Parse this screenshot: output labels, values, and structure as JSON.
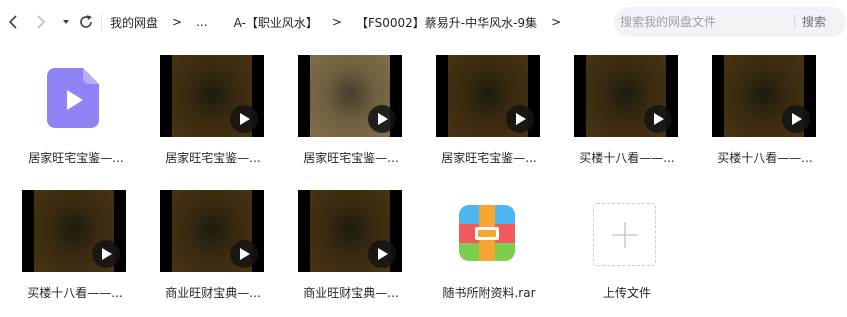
{
  "toolbar": {
    "icons": [
      "chevron-left-icon",
      "chevron-right-icon",
      "caret-down-icon",
      "refresh-icon"
    ],
    "breadcrumbs": [
      {
        "label": "我的网盘"
      },
      {
        "label": "..."
      },
      {
        "label": "A-【职业风水】"
      },
      {
        "label": "【FS0002】蔡易升-中华风水-9集"
      }
    ],
    "separator": ">",
    "search": {
      "placeholder": "搜索我的网盘文件",
      "value": "",
      "button_label": "搜索"
    }
  },
  "files": [
    {
      "name": "居家旺宅宝鉴—...",
      "kind": "video-file",
      "icon": "play-document-icon"
    },
    {
      "name": "居家旺宅宝鉴—...",
      "kind": "video",
      "icon": "play-icon"
    },
    {
      "name": "居家旺宅宝鉴—...",
      "kind": "video",
      "icon": "play-icon"
    },
    {
      "name": "居家旺宅宝鉴—...",
      "kind": "video",
      "icon": "play-icon"
    },
    {
      "name": "买楼十八看——...",
      "kind": "video",
      "icon": "play-icon"
    },
    {
      "name": "买楼十八看——...",
      "kind": "video",
      "icon": "play-icon"
    },
    {
      "name": "买楼十八看——...",
      "kind": "video",
      "icon": "play-icon"
    },
    {
      "name": "商业旺财宝典—...",
      "kind": "video",
      "icon": "play-icon"
    },
    {
      "name": "商业旺财宝典—...",
      "kind": "video",
      "icon": "play-icon"
    },
    {
      "name": "随书所附资料.rar",
      "kind": "archive",
      "icon": "rar-archive-icon"
    }
  ],
  "upload": {
    "label": "上传文件",
    "icon": "plus-icon"
  },
  "colors": {
    "doc_icon": "#8f83f5",
    "search_bg": "#f2f3f7",
    "rar_blue": "#4fb5f2",
    "rar_orange": "#f7a531",
    "rar_red": "#f05a5a",
    "rar_green": "#7ccf4e"
  }
}
